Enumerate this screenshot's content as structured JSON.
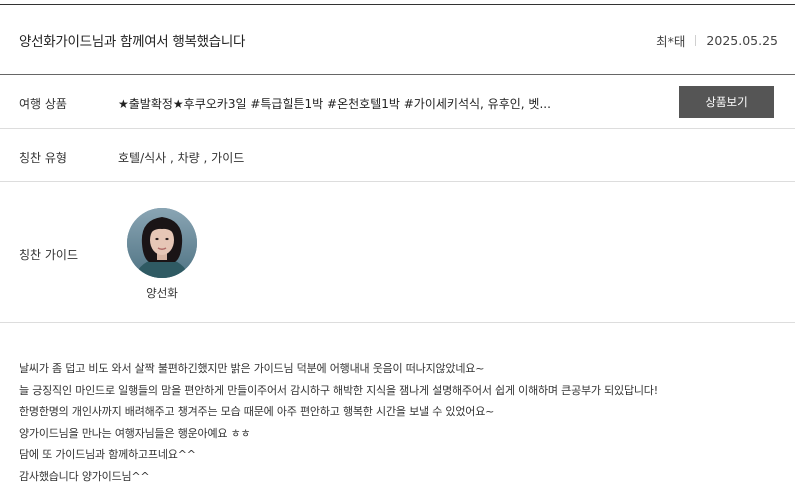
{
  "review": {
    "title": "양선화가이드님과 함께여서 행복했습니다",
    "author": "최*태",
    "date": "2025.05.25"
  },
  "product": {
    "label": "여행 상품",
    "name": "★출발확정★후쿠오카3일 #특급힐튼1박 #온천호텔1박 #가이세키석식, 유후인, 벳...",
    "button_label": "상품보기"
  },
  "praise_type": {
    "label": "칭찬 유형",
    "value": "호텔/식사 , 차량 , 가이드"
  },
  "guide": {
    "label": "칭찬 가이드",
    "name": "양선화"
  },
  "body_lines": [
    "날씨가 좀 덥고 비도 와서 살짝 불편하긴했지만 밝은 가이드님 덕분에 어행내내 웃음이 떠나지않았네요~",
    "늘 긍징직인 마인드로 일행들의 맘을 편안하게 만들이주어서 감시하구 해박한 지식을 잼나게 설명해주어서 쉽게 이해하며 큰공부가 되있답니다!",
    "한명한명의 개인사까지 배려해주고 챙겨주는 모습 때문에 아주 편안하고 행복한 시간을 보낼 수 있었어요~",
    "양가이드님을 만나는 여행자님들은 행운아예요 ㅎㅎ",
    "담에 또 가이드님과 함께하고프네요^^",
    "감사했습니다 양가이드님^^"
  ]
}
